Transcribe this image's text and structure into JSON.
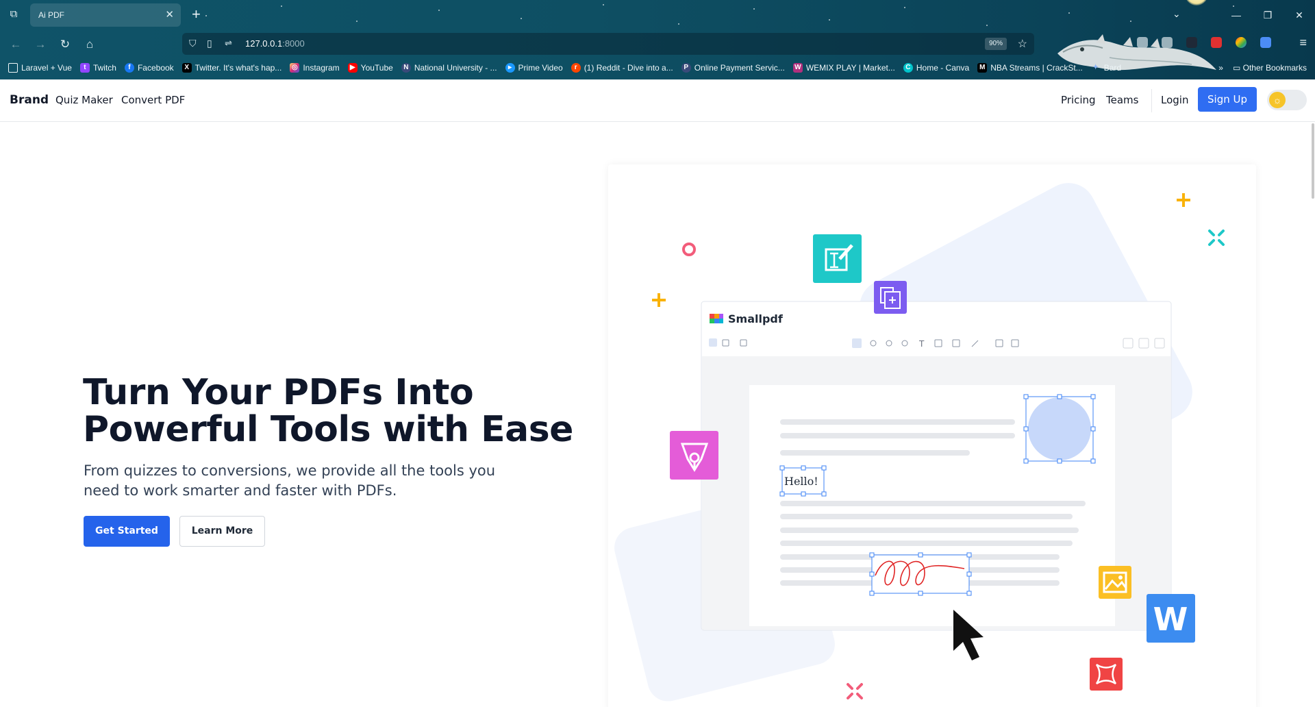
{
  "browser": {
    "tab_title": "Ai PDF",
    "tab_close": "✕",
    "new_tab": "+",
    "url_host": "127.0.0.1",
    "url_port": ":8000",
    "zoom": "90%",
    "bookmarks": [
      {
        "label": "Laravel + Vue",
        "icon": "folder-icon"
      },
      {
        "label": "Twitch",
        "icon": "twitch-icon"
      },
      {
        "label": "Facebook",
        "icon": "facebook-icon"
      },
      {
        "label": "Twitter. It's what's hap...",
        "icon": "x-icon"
      },
      {
        "label": "Instagram",
        "icon": "instagram-icon"
      },
      {
        "label": "YouTube",
        "icon": "youtube-icon"
      },
      {
        "label": "National University - ...",
        "icon": "university-icon"
      },
      {
        "label": "Prime Video",
        "icon": "prime-video-icon"
      },
      {
        "label": "(1) Reddit - Dive into a...",
        "icon": "reddit-icon"
      },
      {
        "label": "Online Payment Servic...",
        "icon": "payment-icon"
      },
      {
        "label": "WEMIX PLAY | Market...",
        "icon": "wemix-icon"
      },
      {
        "label": "Home - Canva",
        "icon": "canva-icon"
      },
      {
        "label": "NBA Streams | CrackSt...",
        "icon": "nba-icon"
      },
      {
        "label": "Bard",
        "icon": "bard-icon"
      }
    ],
    "other_bookmarks": "Other Bookmarks"
  },
  "site": {
    "brand": "Brand",
    "nav_left": [
      "Quiz Maker",
      "Convert PDF"
    ],
    "nav_right": [
      "Pricing",
      "Teams"
    ],
    "login": "Login",
    "signup": "Sign Up"
  },
  "hero": {
    "title_line1": "Turn Your PDFs Into",
    "title_line2": "Powerful Tools with Ease",
    "subtitle_line1": "From quizzes to conversions, we provide all the tools you",
    "subtitle_line2": "need to work smarter and faster with PDFs.",
    "cta_primary": "Get Started",
    "cta_secondary": "Learn More"
  },
  "illustration": {
    "app_name": "Smallpdf",
    "sample_text": "Hello!",
    "word_letter": "W"
  },
  "colors": {
    "primary": "#2563eb",
    "signup": "#2f6df2",
    "chrome": "#0e4f63"
  }
}
